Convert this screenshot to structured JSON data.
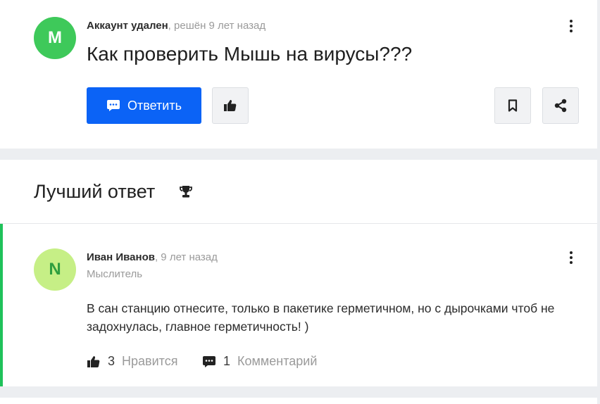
{
  "question": {
    "avatar_letter": "M",
    "author": "Аккаунт удален",
    "time": ", решён 9 лет назад",
    "title": "Как проверить Мышь на вирусы???",
    "reply_label": "Ответить"
  },
  "best_answer": {
    "heading": "Лучший ответ",
    "avatar_letter": "N",
    "author": "Иван Иванов",
    "time": ", 9 лет назад",
    "rank": "Мыслитель",
    "text": "В сан станцию отнесите, только в пакетике герметичном, но с дырочками чтоб не задохнулась, главное герметичность! )",
    "likes_count": "3",
    "likes_label": "Нравится",
    "comments_count": "1",
    "comments_label": "Комментарий"
  },
  "colors": {
    "primary": "#0b63f6",
    "accent_green": "#1fc25a",
    "avatar_question": "#3ec95a",
    "avatar_answer": "#c6ef86"
  },
  "icons": [
    "kebab-icon",
    "chat-icon",
    "thumbs-up-icon",
    "bookmark-icon",
    "share-icon",
    "trophy-icon",
    "comment-icon"
  ]
}
